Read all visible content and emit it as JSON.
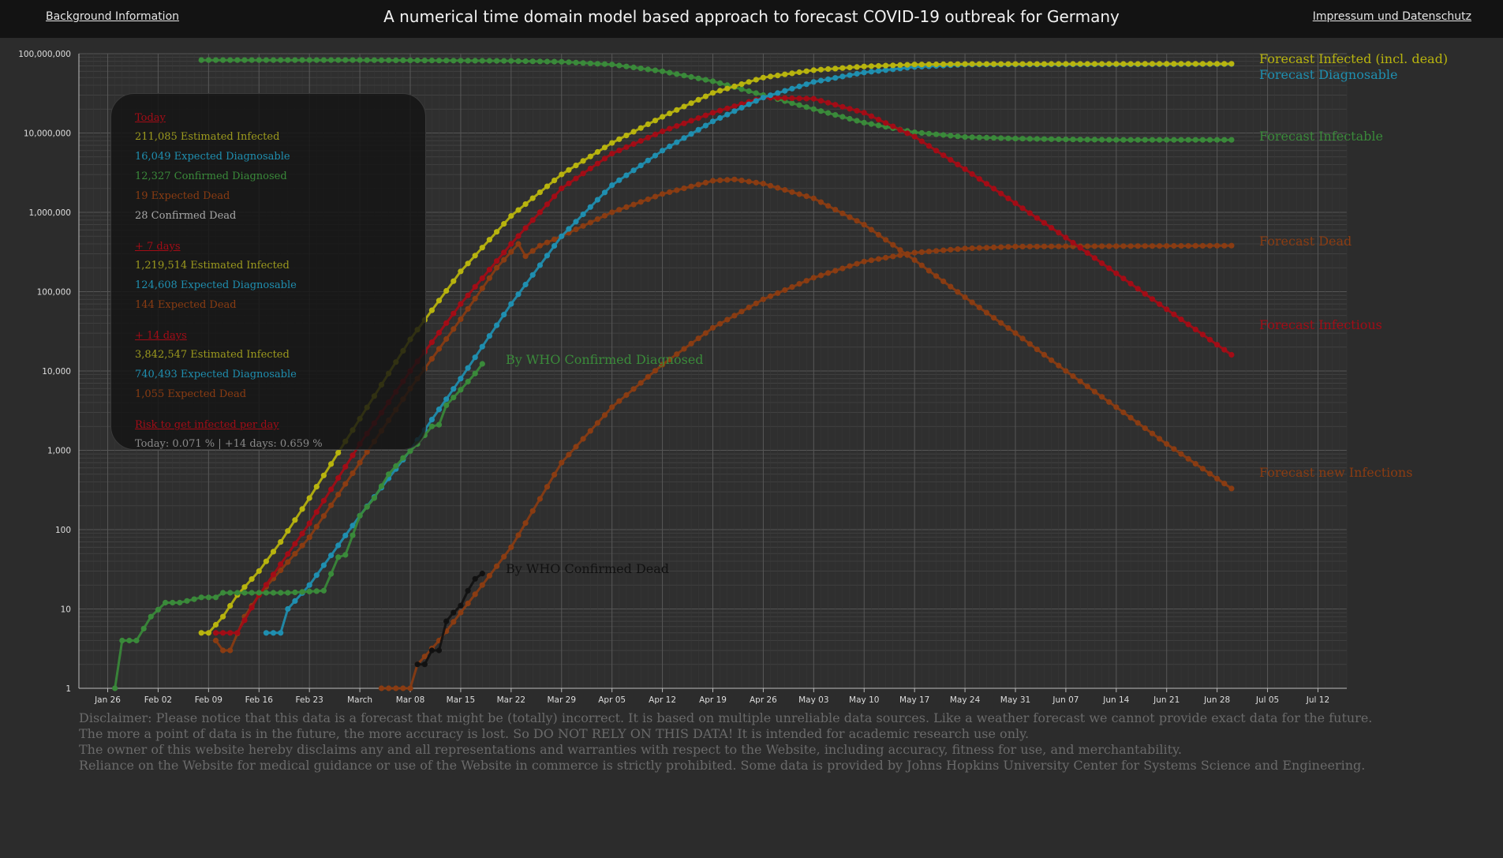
{
  "header": {
    "background_link": "Background Information",
    "title": "A numerical time domain model based approach to forecast COVID-19 outbreak for Germany",
    "imprint_link": "Impressum und Datenschutz"
  },
  "tooltip": {
    "sections": [
      {
        "heading": "Today",
        "lines": [
          {
            "text": "211,085 Estimated Infected",
            "color": "#9c9a1e"
          },
          {
            "text": "16,049 Expected Diagnosable",
            "color": "#1f8fb0"
          },
          {
            "text": "12,327 Confirmed Diagnosed",
            "color": "#3a8a3a"
          },
          {
            "text": "19 Expected Dead",
            "color": "#8a3c12"
          },
          {
            "text": "28 Confirmed Dead",
            "color": "#a8a8a8"
          }
        ]
      },
      {
        "heading": "+ 7 days",
        "lines": [
          {
            "text": "1,219,514 Estimated Infected",
            "color": "#9c9a1e"
          },
          {
            "text": "124,608 Expected Diagnosable",
            "color": "#1f8fb0"
          },
          {
            "text": "144 Expected Dead",
            "color": "#8a3c12"
          }
        ]
      },
      {
        "heading": "+ 14 days",
        "lines": [
          {
            "text": "3,842,547 Estimated Infected",
            "color": "#9c9a1e"
          },
          {
            "text": "740,493 Expected Diagnosable",
            "color": "#1f8fb0"
          },
          {
            "text": "1,055 Expected Dead",
            "color": "#8a3c12"
          }
        ]
      },
      {
        "heading": "Risk to get infected per day",
        "lines": [
          {
            "text": "Today: 0.071 % | +14 days: 0.659 %",
            "color": "#8a8a8a"
          }
        ]
      }
    ]
  },
  "disclaimer": [
    "Disclaimer: Please notice that this data is a forecast that might be (totally) incorrect. It is based on multiple unreliable data sources. Like a weather forecast we cannot provide exact data for the future.",
    "The more a point of data is in the future, the more accuracy is lost. So DO NOT RELY ON THIS DATA! It is intended for academic research use only.",
    "The owner of this website hereby disclaims any and all representations and warranties with respect to the Website, including accuracy, fitness for use, and merchantability.",
    "Reliance on the Website for medical guidance or use of the Website in commerce is strictly prohibited. Some data is provided by Johns Hopkins University Center for Systems Science and Engineering."
  ],
  "chart_data": {
    "type": "line",
    "title": "A numerical time domain model based approach to forecast COVID-19 outbreak for Germany",
    "xlabel": "",
    "ylabel": "",
    "yscale": "log",
    "ylim": [
      1,
      100000000
    ],
    "xlim": [
      "2020-01-22",
      "2020-07-16"
    ],
    "grid": true,
    "legend": "right-side labels at line ends",
    "x_ticks": [
      {
        "date": "2020-01-26",
        "label": "Jan 26"
      },
      {
        "date": "2020-02-02",
        "label": "Feb 02"
      },
      {
        "date": "2020-02-09",
        "label": "Feb 09"
      },
      {
        "date": "2020-02-16",
        "label": "Feb 16"
      },
      {
        "date": "2020-02-23",
        "label": "Feb 23"
      },
      {
        "date": "2020-03-01",
        "label": "March"
      },
      {
        "date": "2020-03-08",
        "label": "Mar 08"
      },
      {
        "date": "2020-03-15",
        "label": "Mar 15"
      },
      {
        "date": "2020-03-22",
        "label": "Mar 22"
      },
      {
        "date": "2020-03-29",
        "label": "Mar 29"
      },
      {
        "date": "2020-04-05",
        "label": "Apr 05"
      },
      {
        "date": "2020-04-12",
        "label": "Apr 12"
      },
      {
        "date": "2020-04-19",
        "label": "Apr 19"
      },
      {
        "date": "2020-04-26",
        "label": "Apr 26"
      },
      {
        "date": "2020-05-03",
        "label": "May 03"
      },
      {
        "date": "2020-05-10",
        "label": "May 10"
      },
      {
        "date": "2020-05-17",
        "label": "May 17"
      },
      {
        "date": "2020-05-24",
        "label": "May 24"
      },
      {
        "date": "2020-05-31",
        "label": "May 31"
      },
      {
        "date": "2020-06-07",
        "label": "Jun 07"
      },
      {
        "date": "2020-06-14",
        "label": "Jun 14"
      },
      {
        "date": "2020-06-21",
        "label": "Jun 21"
      },
      {
        "date": "2020-06-28",
        "label": "Jun 28"
      },
      {
        "date": "2020-07-05",
        "label": "Jul 05"
      },
      {
        "date": "2020-07-12",
        "label": "Jul 12"
      }
    ],
    "y_ticks": [
      {
        "value": 1,
        "label": "1"
      },
      {
        "value": 10,
        "label": "10"
      },
      {
        "value": 100,
        "label": "100"
      },
      {
        "value": 1000,
        "label": "1,000"
      },
      {
        "value": 10000,
        "label": "10,000"
      },
      {
        "value": 100000,
        "label": "100,000"
      },
      {
        "value": 1000000,
        "label": "1,000,000"
      },
      {
        "value": 10000000,
        "label": "10,000,000"
      },
      {
        "value": 100000000,
        "label": "100,000,000"
      }
    ],
    "series": [
      {
        "name": "Forecast Infectable",
        "color": "#3a8a3a",
        "points": [
          [
            "2020-02-08",
            83000000
          ],
          [
            "2020-03-01",
            83000000
          ],
          [
            "2020-03-22",
            81000000
          ],
          [
            "2020-03-29",
            79000000
          ],
          [
            "2020-04-05",
            73000000
          ],
          [
            "2020-04-12",
            60000000
          ],
          [
            "2020-04-19",
            45000000
          ],
          [
            "2020-04-26",
            30000000
          ],
          [
            "2020-05-03",
            20000000
          ],
          [
            "2020-05-10",
            13500000
          ],
          [
            "2020-05-17",
            10200000
          ],
          [
            "2020-05-24",
            8900000
          ],
          [
            "2020-05-31",
            8500000
          ],
          [
            "2020-06-07",
            8300000
          ],
          [
            "2020-06-14",
            8200000
          ],
          [
            "2020-06-21",
            8200000
          ],
          [
            "2020-06-30",
            8200000
          ]
        ]
      },
      {
        "name": "Forecast Infected (incl. dead)",
        "color": "#b8b40e",
        "points": [
          [
            "2020-02-08",
            5
          ],
          [
            "2020-02-09",
            5
          ],
          [
            "2020-02-11",
            8
          ],
          [
            "2020-02-13",
            15
          ],
          [
            "2020-02-16",
            30
          ],
          [
            "2020-02-19",
            70
          ],
          [
            "2020-02-23",
            250
          ],
          [
            "2020-03-01",
            2500
          ],
          [
            "2020-03-08",
            25000
          ],
          [
            "2020-03-15",
            180000
          ],
          [
            "2020-03-22",
            900000
          ],
          [
            "2020-03-29",
            3000000
          ],
          [
            "2020-04-05",
            7500000
          ],
          [
            "2020-04-12",
            16000000
          ],
          [
            "2020-04-19",
            32000000
          ],
          [
            "2020-04-26",
            50000000
          ],
          [
            "2020-05-03",
            62000000
          ],
          [
            "2020-05-10",
            69000000
          ],
          [
            "2020-05-17",
            73000000
          ],
          [
            "2020-05-24",
            74000000
          ],
          [
            "2020-06-30",
            74500000
          ]
        ]
      },
      {
        "name": "Forecast Diagnosable",
        "color": "#1f8fb0",
        "points": [
          [
            "2020-02-17",
            5
          ],
          [
            "2020-02-19",
            5
          ],
          [
            "2020-02-20",
            10
          ],
          [
            "2020-02-23",
            20
          ],
          [
            "2020-03-01",
            150
          ],
          [
            "2020-03-08",
            1000
          ],
          [
            "2020-03-15",
            8000
          ],
          [
            "2020-03-22",
            70000
          ],
          [
            "2020-03-29",
            500000
          ],
          [
            "2020-04-05",
            2200000
          ],
          [
            "2020-04-12",
            6000000
          ],
          [
            "2020-04-19",
            14000000
          ],
          [
            "2020-04-26",
            28000000
          ],
          [
            "2020-05-03",
            44000000
          ],
          [
            "2020-05-10",
            58000000
          ],
          [
            "2020-05-17",
            68000000
          ],
          [
            "2020-05-24",
            73000000
          ],
          [
            "2020-06-30",
            74000000
          ]
        ]
      },
      {
        "name": "Forecast Infectious",
        "color": "#a30c16",
        "points": [
          [
            "2020-02-10",
            5
          ],
          [
            "2020-02-13",
            5
          ],
          [
            "2020-02-16",
            15
          ],
          [
            "2020-02-23",
            120
          ],
          [
            "2020-03-01",
            1200
          ],
          [
            "2020-03-08",
            10000
          ],
          [
            "2020-03-15",
            70000
          ],
          [
            "2020-03-22",
            400000
          ],
          [
            "2020-03-29",
            2000000
          ],
          [
            "2020-04-05",
            5500000
          ],
          [
            "2020-04-12",
            10500000
          ],
          [
            "2020-04-19",
            18000000
          ],
          [
            "2020-04-26",
            28000000
          ],
          [
            "2020-05-03",
            27000000
          ],
          [
            "2020-05-10",
            18000000
          ],
          [
            "2020-05-17",
            9000000
          ],
          [
            "2020-05-24",
            3500000
          ],
          [
            "2020-05-31",
            1300000
          ],
          [
            "2020-06-07",
            480000
          ],
          [
            "2020-06-14",
            170000
          ],
          [
            "2020-06-21",
            60000
          ],
          [
            "2020-06-30",
            16000
          ]
        ]
      },
      {
        "name": "Forecast new Infections",
        "color": "#8a3c12",
        "points": [
          [
            "2020-02-10",
            4
          ],
          [
            "2020-02-11",
            3
          ],
          [
            "2020-02-12",
            3
          ],
          [
            "2020-02-14",
            8
          ],
          [
            "2020-02-16",
            15
          ],
          [
            "2020-02-23",
            80
          ],
          [
            "2020-03-01",
            700
          ],
          [
            "2020-03-08",
            6000
          ],
          [
            "2020-03-15",
            45000
          ],
          [
            "2020-03-20",
            200000
          ],
          [
            "2020-03-23",
            400000
          ],
          [
            "2020-03-24",
            280000
          ],
          [
            "2020-03-26",
            380000
          ],
          [
            "2020-03-29",
            500000
          ],
          [
            "2020-04-05",
            1000000
          ],
          [
            "2020-04-12",
            1700000
          ],
          [
            "2020-04-19",
            2500000
          ],
          [
            "2020-04-22",
            2600000
          ],
          [
            "2020-04-26",
            2300000
          ],
          [
            "2020-05-03",
            1500000
          ],
          [
            "2020-05-10",
            700000
          ],
          [
            "2020-05-17",
            250000
          ],
          [
            "2020-05-24",
            85000
          ],
          [
            "2020-05-31",
            30000
          ],
          [
            "2020-06-07",
            10000
          ],
          [
            "2020-06-14",
            3500
          ],
          [
            "2020-06-21",
            1200
          ],
          [
            "2020-06-30",
            330
          ]
        ]
      },
      {
        "name": "Forecast Dead",
        "color": "#8a3c12",
        "points": [
          [
            "2020-03-04",
            1
          ],
          [
            "2020-03-08",
            1
          ],
          [
            "2020-03-09",
            2
          ],
          [
            "2020-03-12",
            4
          ],
          [
            "2020-03-15",
            9
          ],
          [
            "2020-03-18",
            20
          ],
          [
            "2020-03-22",
            60
          ],
          [
            "2020-03-29",
            700
          ],
          [
            "2020-04-05",
            3500
          ],
          [
            "2020-04-12",
            12000
          ],
          [
            "2020-04-19",
            35000
          ],
          [
            "2020-04-26",
            80000
          ],
          [
            "2020-05-03",
            150000
          ],
          [
            "2020-05-10",
            240000
          ],
          [
            "2020-05-17",
            310000
          ],
          [
            "2020-05-24",
            350000
          ],
          [
            "2020-05-31",
            370000
          ],
          [
            "2020-06-30",
            380000
          ]
        ]
      },
      {
        "name": "By WHO Confirmed Diagnosed",
        "color": "#3a8a3a",
        "points": [
          [
            "2020-01-27",
            1
          ],
          [
            "2020-01-28",
            4
          ],
          [
            "2020-01-30",
            4
          ],
          [
            "2020-02-01",
            8
          ],
          [
            "2020-02-03",
            12
          ],
          [
            "2020-02-05",
            12
          ],
          [
            "2020-02-08",
            14
          ],
          [
            "2020-02-10",
            14
          ],
          [
            "2020-02-11",
            16
          ],
          [
            "2020-02-20",
            16
          ],
          [
            "2020-02-25",
            17
          ],
          [
            "2020-02-27",
            45
          ],
          [
            "2020-02-28",
            48
          ],
          [
            "2020-03-01",
            150
          ],
          [
            "2020-03-03",
            250
          ],
          [
            "2020-03-05",
            500
          ],
          [
            "2020-03-07",
            800
          ],
          [
            "2020-03-09",
            1200
          ],
          [
            "2020-03-11",
            2000
          ],
          [
            "2020-03-12",
            2100
          ],
          [
            "2020-03-13",
            3700
          ],
          [
            "2020-03-15",
            5800
          ],
          [
            "2020-03-17",
            9300
          ],
          [
            "2020-03-18",
            12300
          ]
        ]
      },
      {
        "name": "By WHO Confirmed Dead",
        "color": "#111111",
        "points": [
          [
            "2020-03-09",
            2
          ],
          [
            "2020-03-10",
            2
          ],
          [
            "2020-03-11",
            3
          ],
          [
            "2020-03-12",
            3
          ],
          [
            "2020-03-13",
            7
          ],
          [
            "2020-03-14",
            9
          ],
          [
            "2020-03-15",
            11
          ],
          [
            "2020-03-16",
            17
          ],
          [
            "2020-03-17",
            24
          ],
          [
            "2020-03-18",
            28
          ]
        ]
      }
    ],
    "labels": [
      {
        "text": "Forecast Infected (incl. dead)",
        "color": "#b8b40e"
      },
      {
        "text": "Forecast Diagnosable",
        "color": "#1f8fb0"
      },
      {
        "text": "Forecast Infectable",
        "color": "#3a8a3a"
      },
      {
        "text": "Forecast Dead",
        "color": "#8a3c12"
      },
      {
        "text": "Forecast Infectious",
        "color": "#a30c16"
      },
      {
        "text": "Forecast new Infections",
        "color": "#8a3c12"
      },
      {
        "text": "By WHO Confirmed Diagnosed",
        "color": "#3a8a3a"
      },
      {
        "text": "By WHO Confirmed Dead",
        "color": "#111111"
      }
    ]
  }
}
